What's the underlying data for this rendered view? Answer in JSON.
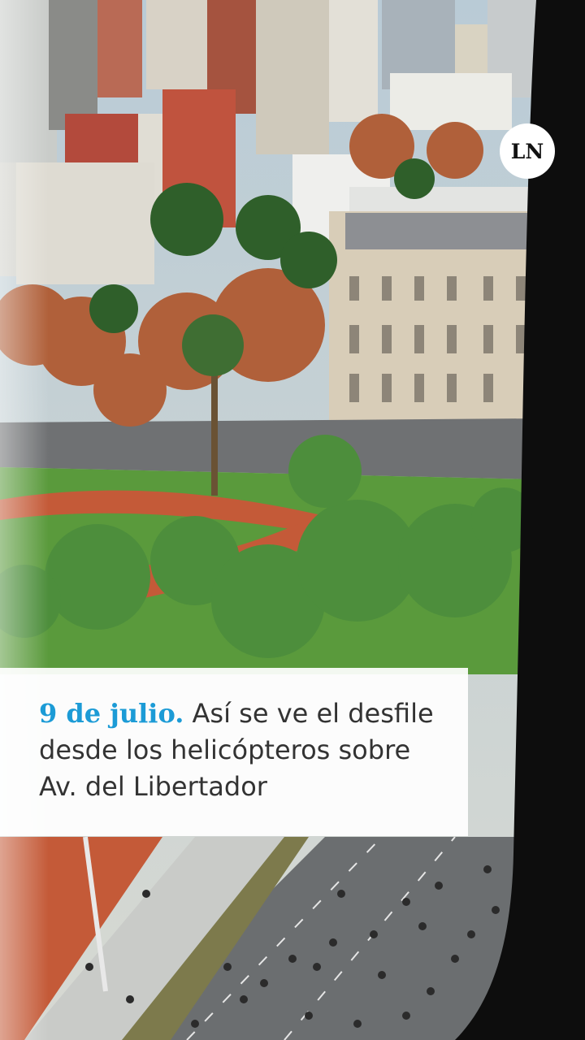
{
  "brand": {
    "logo_text": "LN"
  },
  "caption": {
    "lead": "9 de julio.",
    "text": " Así se ve el desfile desde los helicópteros sobre Av. del Libertador"
  },
  "colors": {
    "lead_accent": "#1c9bd6",
    "caption_text": "#333333",
    "frame": "#0d0d0d"
  }
}
